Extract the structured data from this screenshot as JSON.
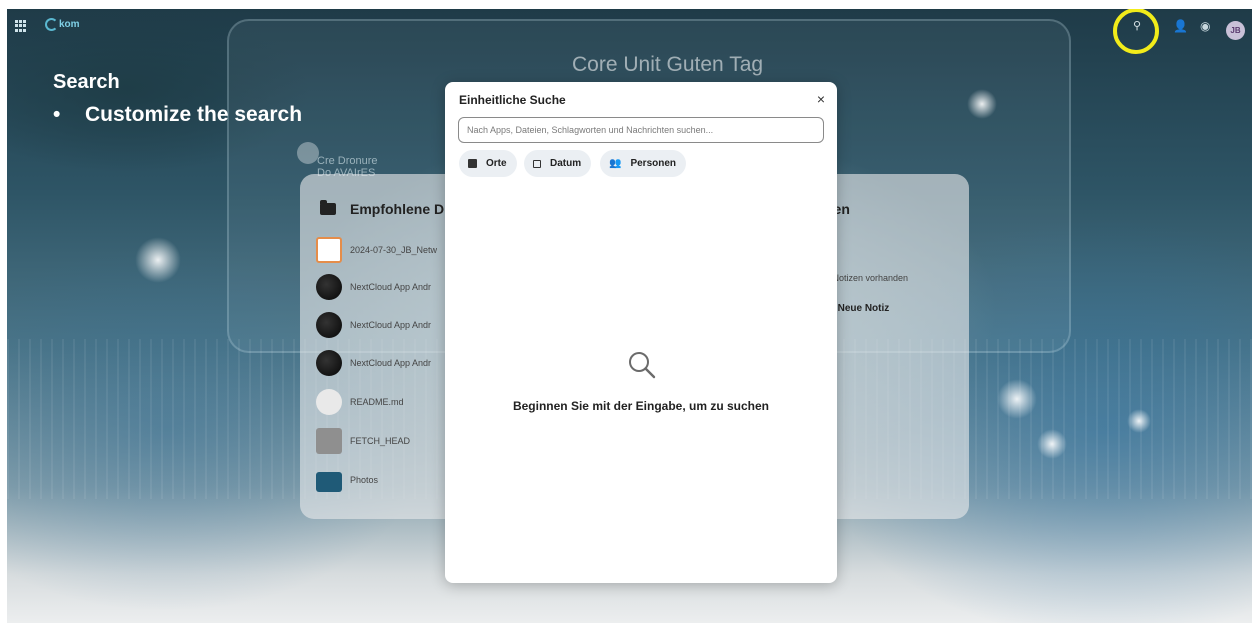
{
  "topbar": {
    "logo_text": "kom",
    "avatar_initials": "JB"
  },
  "slide": {
    "title": "Search",
    "bullet": "Customize the search",
    "bullet_marker": "•"
  },
  "background": {
    "dashboard_title": "Core Unit Guten Tag",
    "subtitle_line1": "Cre Dronure",
    "subtitle_line2": "Do AVAIrES"
  },
  "recommended_files": {
    "heading": "Empfohlene D",
    "items": [
      {
        "name": "2024-07-30_JB_Netw",
        "thumb": "orange"
      },
      {
        "name": "NextCloud App Andr",
        "thumb": "dark"
      },
      {
        "name": "NextCloud App Andr",
        "thumb": "dark"
      },
      {
        "name": "NextCloud App Andr",
        "thumb": "dark"
      },
      {
        "name": "README.md",
        "thumb": "doc"
      },
      {
        "name": "FETCH_HEAD",
        "thumb": "gray"
      },
      {
        "name": "Photos",
        "thumb": "folder"
      }
    ]
  },
  "notes": {
    "heading": "tizen",
    "empty": "ine Notizen vorhanden",
    "new_note": "Neue Notiz",
    "plus": "+"
  },
  "search_modal": {
    "title": "Einheitliche Suche",
    "close": "×",
    "input_value": "",
    "input_placeholder": "Nach Apps, Dateien, Schlagworten und Nachrichten suchen...",
    "filters": {
      "places": "Orte",
      "date": "Datum",
      "people": "Personen"
    },
    "empty_state": "Beginnen Sie mit der Eingabe, um zu suchen"
  },
  "colors": {
    "highlight_ring": "#f2ec1a",
    "folder_blue": "#1f5a77",
    "chip_bg": "#ebeff3"
  }
}
